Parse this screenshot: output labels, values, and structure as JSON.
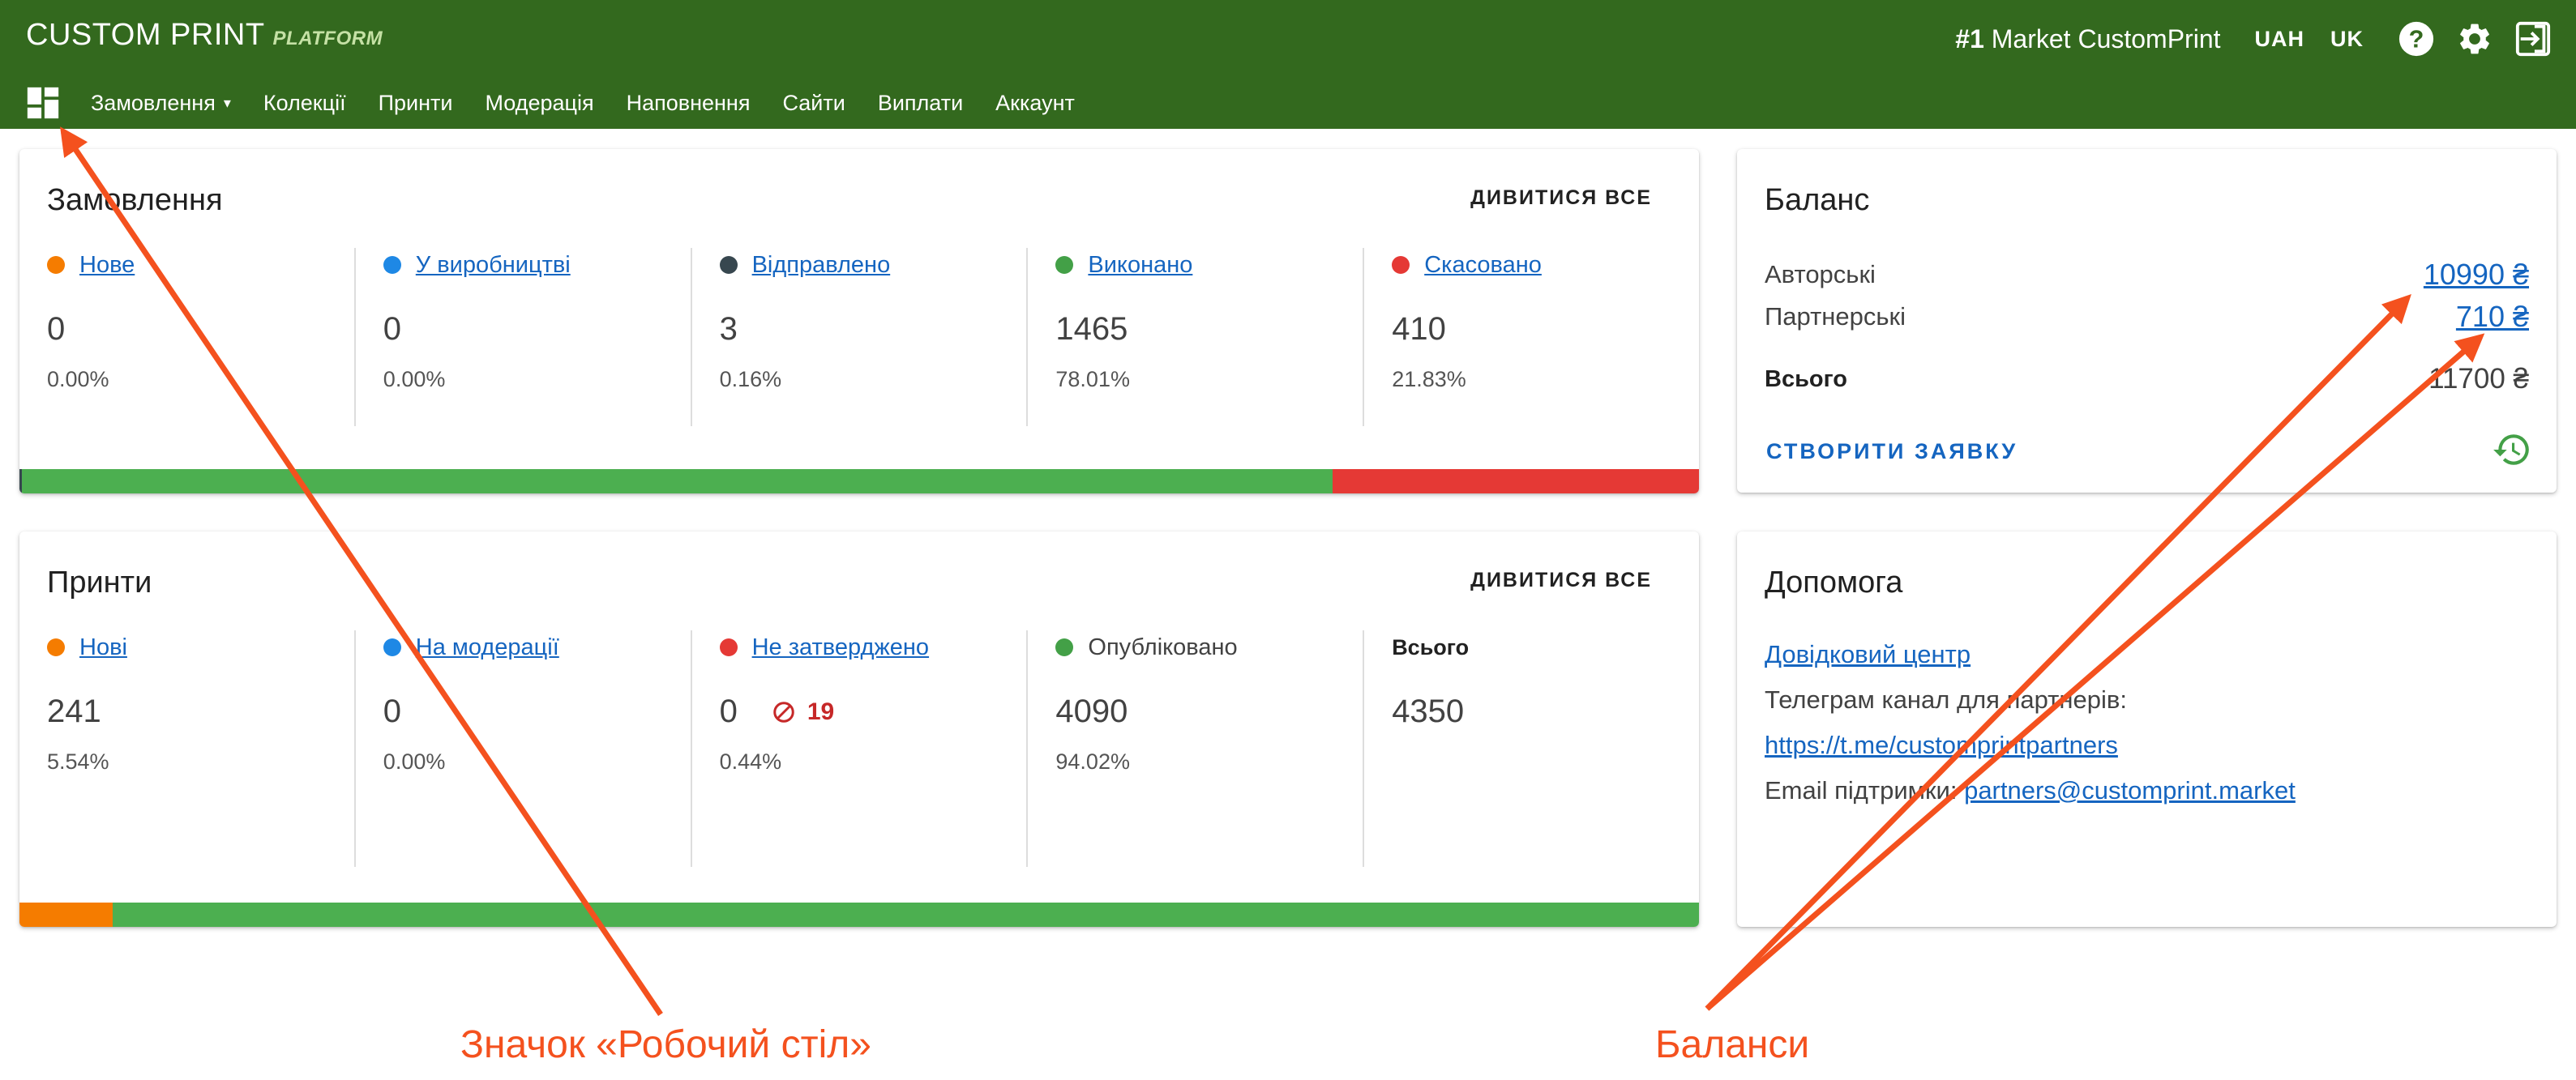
{
  "header": {
    "logo": "CUSTOM PRINT",
    "logo_sub": "PLATFORM",
    "market_prefix": "#1",
    "market_name": "Market CustomPrint",
    "currency": "UAH",
    "language": "UK",
    "icons": [
      "help-icon",
      "settings-icon",
      "logout-icon"
    ]
  },
  "nav": {
    "dashboard_icon": "dashboard-icon",
    "items": [
      {
        "label": "Замовлення",
        "dropdown": true
      },
      {
        "label": "Колекції"
      },
      {
        "label": "Принти"
      },
      {
        "label": "Модерація"
      },
      {
        "label": "Наповнення"
      },
      {
        "label": "Сайти"
      },
      {
        "label": "Виплати"
      },
      {
        "label": "Аккаунт"
      }
    ]
  },
  "orders": {
    "title": "Замовлення",
    "see_all": "ДИВИТИСЯ ВСЕ",
    "stats": [
      {
        "label": "Нове",
        "value": "0",
        "pct": "0.00%",
        "color": "#f57c00"
      },
      {
        "label": "У виробництві",
        "value": "0",
        "pct": "0.00%",
        "color": "#1e88e5"
      },
      {
        "label": "Відправлено",
        "value": "3",
        "pct": "0.16%",
        "color": "#37474f"
      },
      {
        "label": "Виконано",
        "value": "1465",
        "pct": "78.01%",
        "color": "#43a047"
      },
      {
        "label": "Скасовано",
        "value": "410",
        "pct": "21.83%",
        "color": "#e53935"
      }
    ],
    "bar": [
      {
        "fraction": 0.0016,
        "color": "#37474f"
      },
      {
        "fraction": 0.7801,
        "color": "#4caf50"
      },
      {
        "fraction": 0.2183,
        "color": "#e53935"
      }
    ]
  },
  "prints": {
    "title": "Принти",
    "see_all": "ДИВИТИСЯ ВСЕ",
    "stats": [
      {
        "label": "Нові",
        "value": "241",
        "pct": "5.54%",
        "color": "#f57c00"
      },
      {
        "label": "На модерації",
        "value": "0",
        "pct": "0.00%",
        "color": "#1e88e5"
      },
      {
        "label": "Не затверджено",
        "value": "0",
        "pct": "0.44%",
        "color": "#e53935",
        "rejected": "19"
      },
      {
        "label": "Опубліковано",
        "value": "4090",
        "pct": "94.02%",
        "color": "#43a047"
      }
    ],
    "total_label": "Всього",
    "total_value": "4350",
    "bar": [
      {
        "fraction": 0.0554,
        "color": "#f57c00"
      },
      {
        "fraction": 0.9446,
        "color": "#4caf50"
      }
    ]
  },
  "balance": {
    "title": "Баланс",
    "author_label": "Авторські",
    "author_amount": "10990 ₴",
    "partner_label": "Партнерські",
    "partner_amount": "710 ₴",
    "total_label": "Всього",
    "total_amount": "11700 ₴",
    "create_button": "СТВОРИТИ ЗАЯВКУ"
  },
  "help": {
    "title": "Допомога",
    "help_center": "Довідковий центр",
    "telegram_label": "Телеграм канал для партнерів:",
    "telegram_link": "https://t.me/customprintpartners",
    "email_label": "Email підтримки:",
    "email_link": "partners@customprint.market"
  },
  "annotations": {
    "dashboard": "Значок «Робочий стіл»",
    "balances": "Баланси",
    "color": "#f4511e"
  }
}
